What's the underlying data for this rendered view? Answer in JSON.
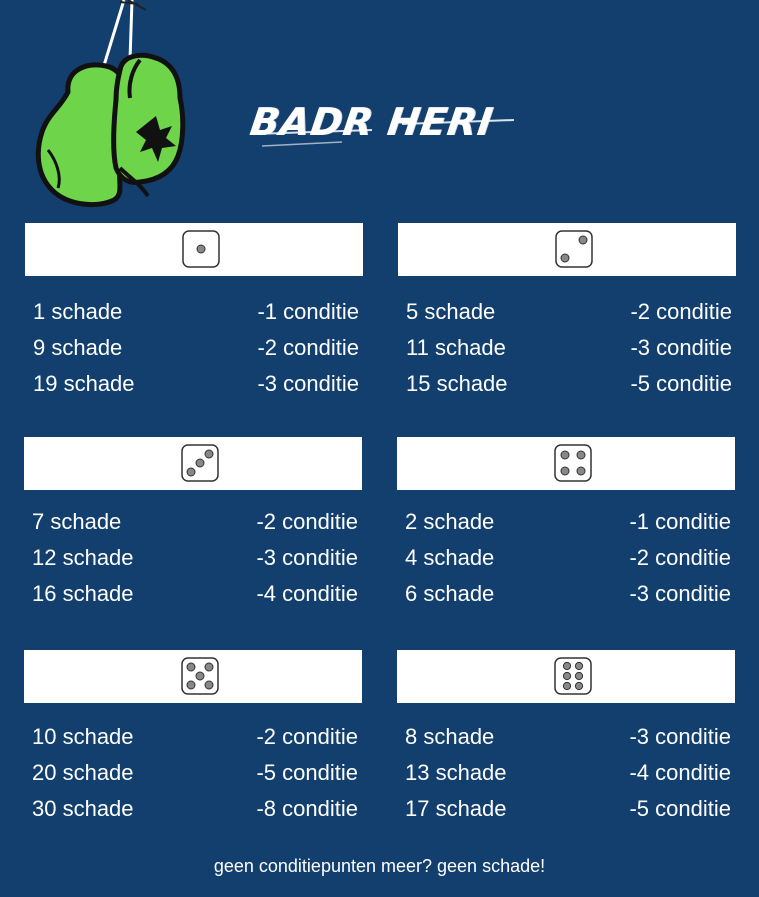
{
  "title": "BADR HERI",
  "logo_icon": "boxing-gloves-icon",
  "colors": {
    "background": "#123f6e",
    "glove_green": "#6ed44a",
    "banner": "#ffffff",
    "text": "#ffffff"
  },
  "panels": [
    {
      "die_face": 1,
      "die_icon": "die-face-1-icon",
      "rows": [
        {
          "damage": "1 schade",
          "condition": "-1 conditie"
        },
        {
          "damage": "9 schade",
          "condition": "-2 conditie"
        },
        {
          "damage": "19 schade",
          "condition": "-3 conditie"
        }
      ]
    },
    {
      "die_face": 2,
      "die_icon": "die-face-2-icon",
      "rows": [
        {
          "damage": "5 schade",
          "condition": "-2 conditie"
        },
        {
          "damage": "11 schade",
          "condition": "-3 conditie"
        },
        {
          "damage": "15 schade",
          "condition": "-5 conditie"
        }
      ]
    },
    {
      "die_face": 3,
      "die_icon": "die-face-3-icon",
      "rows": [
        {
          "damage": "7 schade",
          "condition": "-2 conditie"
        },
        {
          "damage": "12 schade",
          "condition": "-3 conditie"
        },
        {
          "damage": "16 schade",
          "condition": "-4 conditie"
        }
      ]
    },
    {
      "die_face": 4,
      "die_icon": "die-face-4-icon",
      "rows": [
        {
          "damage": "2 schade",
          "condition": "-1 conditie"
        },
        {
          "damage": "4 schade",
          "condition": "-2 conditie"
        },
        {
          "damage": "6 schade",
          "condition": "-3 conditie"
        }
      ]
    },
    {
      "die_face": 5,
      "die_icon": "die-face-5-icon",
      "rows": [
        {
          "damage": "10 schade",
          "condition": "-2 conditie"
        },
        {
          "damage": "20 schade",
          "condition": "-5 conditie"
        },
        {
          "damage": "30 schade",
          "condition": "-8 conditie"
        }
      ]
    },
    {
      "die_face": 6,
      "die_icon": "die-face-6-icon",
      "rows": [
        {
          "damage": "8 schade",
          "condition": "-3 conditie"
        },
        {
          "damage": "13 schade",
          "condition": "-4 conditie"
        },
        {
          "damage": "17 schade",
          "condition": "-5 conditie"
        }
      ]
    }
  ],
  "footer": "geen conditiepunten meer? geen schade!"
}
